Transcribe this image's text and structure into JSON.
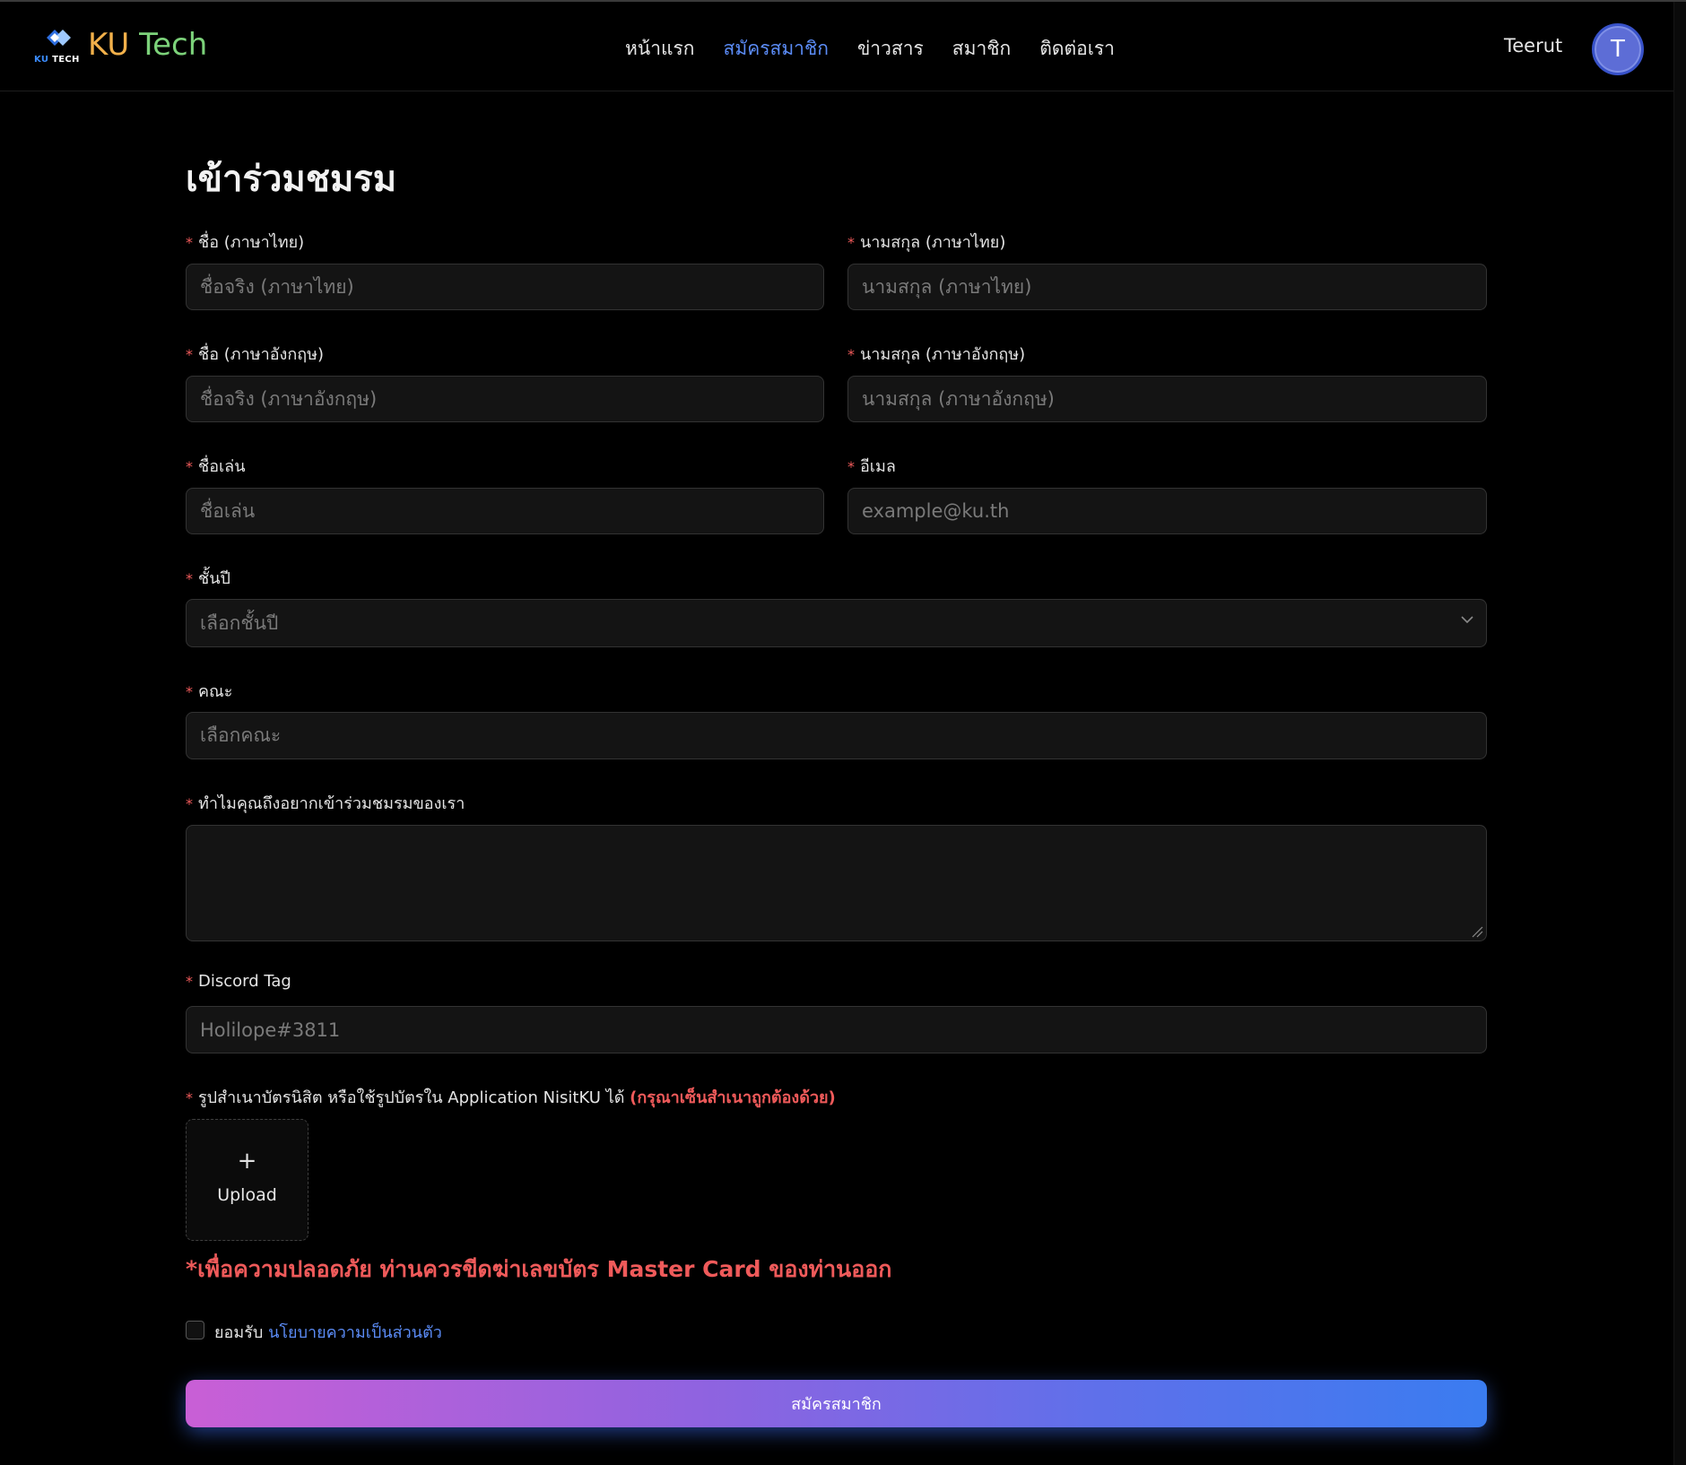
{
  "brand": {
    "logo_sub_ku": "KU",
    "logo_sub_tech": "TECH",
    "name_part1": "KU",
    "name_part2": "Tech"
  },
  "nav": {
    "items": [
      {
        "label": "หน้าแรก"
      },
      {
        "label": "สมัครสมาชิก",
        "active": true
      },
      {
        "label": "ข่าวสาร"
      },
      {
        "label": "สมาชิก"
      },
      {
        "label": "ติดต่อเรา"
      }
    ]
  },
  "user": {
    "name": "Teerut",
    "avatar_initial": "T"
  },
  "form": {
    "title": "เข้าร่วมชมรม",
    "required_mark": "*",
    "first_name_th": {
      "label": "ชื่อ (ภาษาไทย)",
      "placeholder": "ชื่อจริง (ภาษาไทย)"
    },
    "last_name_th": {
      "label": "นามสกุล (ภาษาไทย)",
      "placeholder": "นามสกุล (ภาษาไทย)"
    },
    "first_name_en": {
      "label": "ชื่อ (ภาษาอังกฤษ)",
      "placeholder": "ชื่อจริง (ภาษาอังกฤษ)"
    },
    "last_name_en": {
      "label": "นามสกุล (ภาษาอังกฤษ)",
      "placeholder": "นามสกุล (ภาษาอังกฤษ)"
    },
    "nickname": {
      "label": "ชื่อเล่น",
      "placeholder": "ชื่อเล่น"
    },
    "email": {
      "label": "อีเมล",
      "placeholder": "example@ku.th"
    },
    "year": {
      "label": "ชั้นปี",
      "placeholder": "เลือกชั้นปี"
    },
    "faculty": {
      "label": "คณะ",
      "placeholder": "เลือกคณะ"
    },
    "reason": {
      "label": "ทำไมคุณถึงอยากเข้าร่วมชมรมของเรา",
      "value": ""
    },
    "discord": {
      "label": "Discord Tag",
      "placeholder": "Holilope#3811"
    },
    "student_card": {
      "label": "รูปสำเนาบัตรนิสิต หรือใช้รูปบัตรใน Application NisitKU ได้",
      "label_warning": "(กรุณาเซ็นสำเนาถูกต้องด้วย)",
      "upload_plus": "+",
      "upload_label": "Upload"
    },
    "security_note": "*เพื่อความปลอดภัย ท่านควรขีดฆ่าเลขบัตร Master Card ของท่านออก",
    "agree_prefix": "ยอมรับ",
    "agree_link": "นโยบายความเป็นส่วนตัว",
    "submit_label": "สมัครสมาชิก"
  },
  "colors": {
    "background": "#000000",
    "accent_blue": "#5b8cf7",
    "required_red": "#ef5a5a",
    "input_bg": "#141414",
    "avatar": "#5d6dd6",
    "button_gradient_start": "#c95fd6",
    "button_gradient_end": "#3a7cf0"
  },
  "icons": {
    "logo": "ku-tech-diamond-logo",
    "select_chevron": "chevron-down-icon",
    "upload": "plus-icon",
    "resize": "resize-handle-icon"
  }
}
